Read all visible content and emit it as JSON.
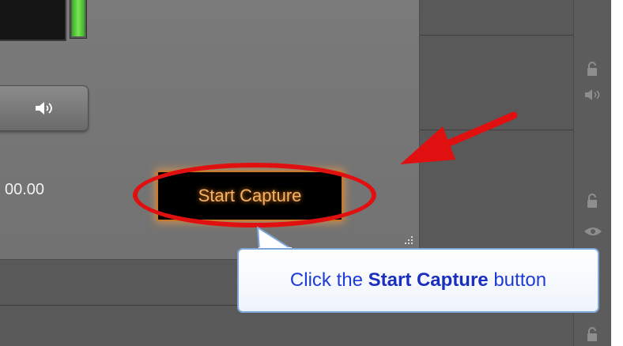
{
  "recorder": {
    "audio_button_icon": "speaker-icon",
    "duration": "00.00",
    "start_capture_label": "Start Capture",
    "level_meter_color": "#43c42b",
    "capture_glow_color": "#ff8c1a"
  },
  "timeline": {
    "track_icons": [
      "lock-icon",
      "speaker-icon",
      "lock-icon",
      "eye-icon",
      "lock-icon"
    ]
  },
  "annotation": {
    "callout_prefix": "Click the ",
    "callout_emphasis": "Start Capture",
    "callout_suffix": " button",
    "highlight_color": "#e01010",
    "callout_text_color": "#1f3bd6"
  }
}
